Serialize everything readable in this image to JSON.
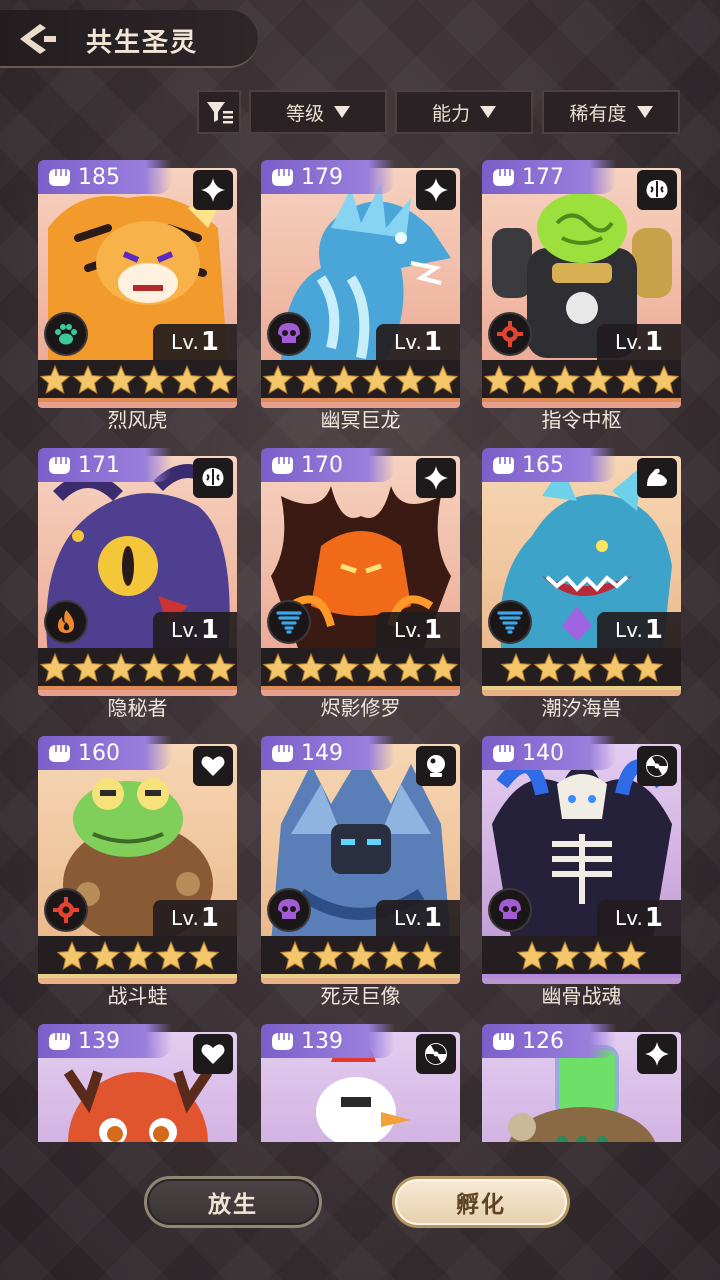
{
  "header": {
    "title": "共生圣灵"
  },
  "filters": {
    "level_label": "等级",
    "ability_label": "能力",
    "rarity_label": "稀有度"
  },
  "cards": [
    {
      "power": "185",
      "name": "烈风虎",
      "level_prefix": "Lv.",
      "level": "1",
      "stars": 6,
      "type_icon": "sparkle-icon",
      "element_icon": "paw-icon",
      "element_color": "#3cc99a"
    },
    {
      "power": "179",
      "name": "幽冥巨龙",
      "level_prefix": "Lv.",
      "level": "1",
      "stars": 6,
      "type_icon": "sparkle-icon",
      "element_icon": "skull-icon",
      "element_color": "#a35bd6"
    },
    {
      "power": "177",
      "name": "指令中枢",
      "level_prefix": "Lv.",
      "level": "1",
      "stars": 6,
      "type_icon": "brain-icon",
      "element_icon": "gear-icon",
      "element_color": "#e2442f"
    },
    {
      "power": "171",
      "name": "隐秘者",
      "level_prefix": "Lv.",
      "level": "1",
      "stars": 6,
      "type_icon": "brain-icon",
      "element_icon": "flame-icon",
      "element_color": "#f08a2a"
    },
    {
      "power": "170",
      "name": "烬影修罗",
      "level_prefix": "Lv.",
      "level": "1",
      "stars": 6,
      "type_icon": "sparkle-icon",
      "element_icon": "tornado-icon",
      "element_color": "#3ba7e8"
    },
    {
      "power": "165",
      "name": "潮汐海兽",
      "level_prefix": "Lv.",
      "level": "1",
      "stars": 5,
      "type_icon": "muscle-icon",
      "element_icon": "tornado-icon",
      "element_color": "#3ba7e8"
    },
    {
      "power": "160",
      "name": "战斗蛙",
      "level_prefix": "Lv.",
      "level": "1",
      "stars": 5,
      "type_icon": "heart-icon",
      "element_icon": "gear-icon",
      "element_color": "#e2442f"
    },
    {
      "power": "149",
      "name": "死灵巨像",
      "level_prefix": "Lv.",
      "level": "1",
      "stars": 5,
      "type_icon": "crystal-ball-icon",
      "element_icon": "skull-icon",
      "element_color": "#a35bd6"
    },
    {
      "power": "140",
      "name": "幽骨战魂",
      "level_prefix": "Lv.",
      "level": "1",
      "stars": 4,
      "type_icon": "radiation-icon",
      "element_icon": "skull-icon",
      "element_color": "#a35bd6"
    },
    {
      "power": "139",
      "name": "",
      "type_icon": "heart-icon"
    },
    {
      "power": "139",
      "name": "",
      "type_icon": "radiation-icon"
    },
    {
      "power": "126",
      "name": "",
      "type_icon": "sparkle-icon"
    }
  ],
  "buttons": {
    "release_label": "放生",
    "hatch_label": "孵化"
  },
  "colors": {
    "accent_purple": "#8b6fd6",
    "star_gold": "#f4c66a",
    "rarity_orange": "#e08a56",
    "rarity_gold": "#e8cf8a",
    "rarity_purple": "#b48ae0"
  }
}
